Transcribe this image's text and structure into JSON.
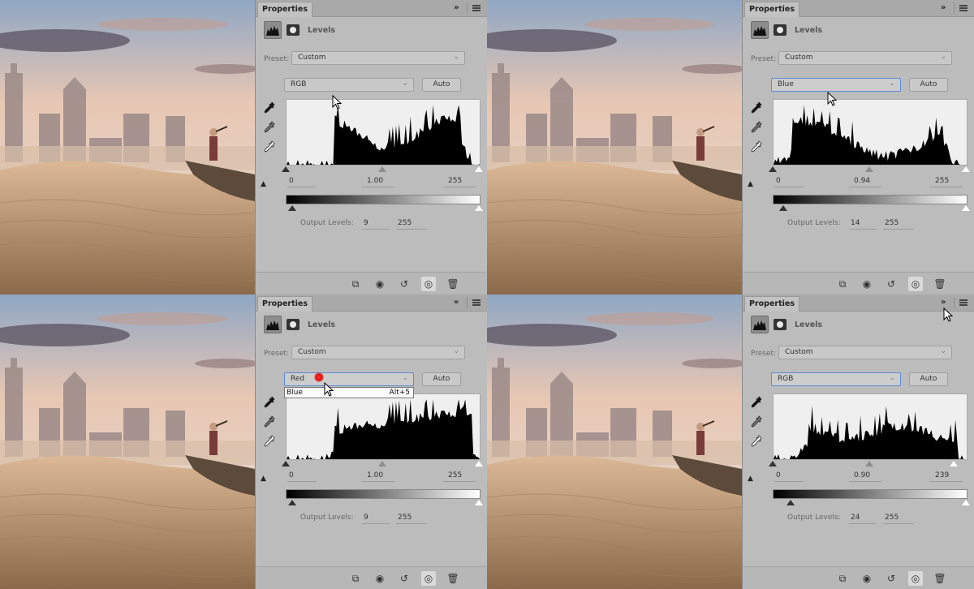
{
  "panels": [
    {
      "tab": "Properties",
      "collapse_glyph": "»",
      "title": "Levels",
      "preset_label": "Preset:",
      "preset_value": "Custom",
      "channel": "RGB",
      "auto_label": "Auto",
      "input_black": "0",
      "input_gamma": "1.00",
      "input_white": "255",
      "output_label": "Output Levels:",
      "output_black": "9",
      "output_white": "255"
    },
    {
      "tab": "Properties",
      "collapse_glyph": "»",
      "title": "Levels",
      "preset_label": "Preset:",
      "preset_value": "Custom",
      "channel": "Blue",
      "auto_label": "Auto",
      "input_black": "0",
      "input_gamma": "0.94",
      "input_white": "255",
      "output_label": "Output Levels:",
      "output_black": "14",
      "output_white": "255"
    },
    {
      "tab": "Properties",
      "collapse_glyph": "»",
      "title": "Levels",
      "preset_label": "Preset:",
      "preset_value": "Custom",
      "channel": "Red",
      "auto_label": "Auto",
      "dropdown_item": "Blue",
      "dropdown_shortcut": "Alt+5",
      "input_black": "0",
      "input_gamma": "1.00",
      "input_white": "255",
      "output_label": "Output Levels:",
      "output_black": "9",
      "output_white": "255"
    },
    {
      "tab": "Properties",
      "collapse_glyph": "»",
      "title": "Levels",
      "preset_label": "Preset:",
      "preset_value": "Custom",
      "channel": "RGB",
      "auto_label": "Auto",
      "input_black": "0",
      "input_gamma": "0.90",
      "input_white": "239",
      "output_label": "Output Levels:",
      "output_black": "24",
      "output_white": "255"
    }
  ],
  "colors": {
    "panel_bg": "#bcbcbc",
    "histogram_fill": "#000000",
    "focus_border": "#5e8ad6",
    "sky_top": "#8fa7c4",
    "sand": "#c9a27a"
  },
  "icons": [
    "levels-adjustment-icon",
    "layer-mask-icon",
    "black-point-eyedropper-icon",
    "gray-point-eyedropper-icon",
    "white-point-eyedropper-icon",
    "clipping-warning-icon",
    "clip-to-layer-icon",
    "view-previous-state-icon",
    "reset-icon",
    "visibility-eye-icon",
    "trash-icon",
    "panel-menu-icon"
  ]
}
